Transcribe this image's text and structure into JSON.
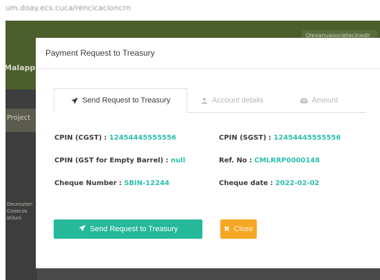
{
  "background": {
    "url_text": "um.doay.ecs.cuca/rencicacioncrn",
    "brand": "Malappu",
    "top_right": "Olevanuasocietecinadir",
    "sidebar_project": "Project",
    "sidebar_list": [
      "Deurouten",
      "Cooecos",
      "stiluni"
    ]
  },
  "modal": {
    "title": "Payment Request to Treasury",
    "tabs": [
      {
        "label": "Send Request to Treasury",
        "icon": "send-icon",
        "active": true
      },
      {
        "label": "Account details",
        "icon": "user-icon",
        "active": false
      },
      {
        "label": "Amount",
        "icon": "envelope-icon",
        "active": false
      }
    ],
    "fields": {
      "cpin_cgst": {
        "label": "CPIN (CGST)",
        "sep": ":",
        "value": "12454445555556"
      },
      "cpin_sgst": {
        "label": "CPIN (SGST)",
        "sep": ":",
        "value": "12454445555556"
      },
      "cpin_gst_empty": {
        "label": "CPIN (GST for Empty Barrel)",
        "sep": ":",
        "value": "null"
      },
      "ref_no": {
        "label": "Ref. No",
        "sep": ":",
        "value": "CMLRRP0000148"
      },
      "cheque_number": {
        "label": "Cheque Number",
        "sep": ":",
        "value": "SBIN-12244"
      },
      "cheque_date": {
        "label": "Cheque date",
        "sep": ":",
        "value": "2022-02-02"
      }
    },
    "buttons": {
      "send_label": "Send Request to Treasury",
      "close_label": "Close"
    }
  },
  "colors": {
    "accent_teal": "#26b89b",
    "value_teal": "#2bbfae",
    "close_orange": "#f5a623",
    "header_green": "#4b5e2c"
  }
}
